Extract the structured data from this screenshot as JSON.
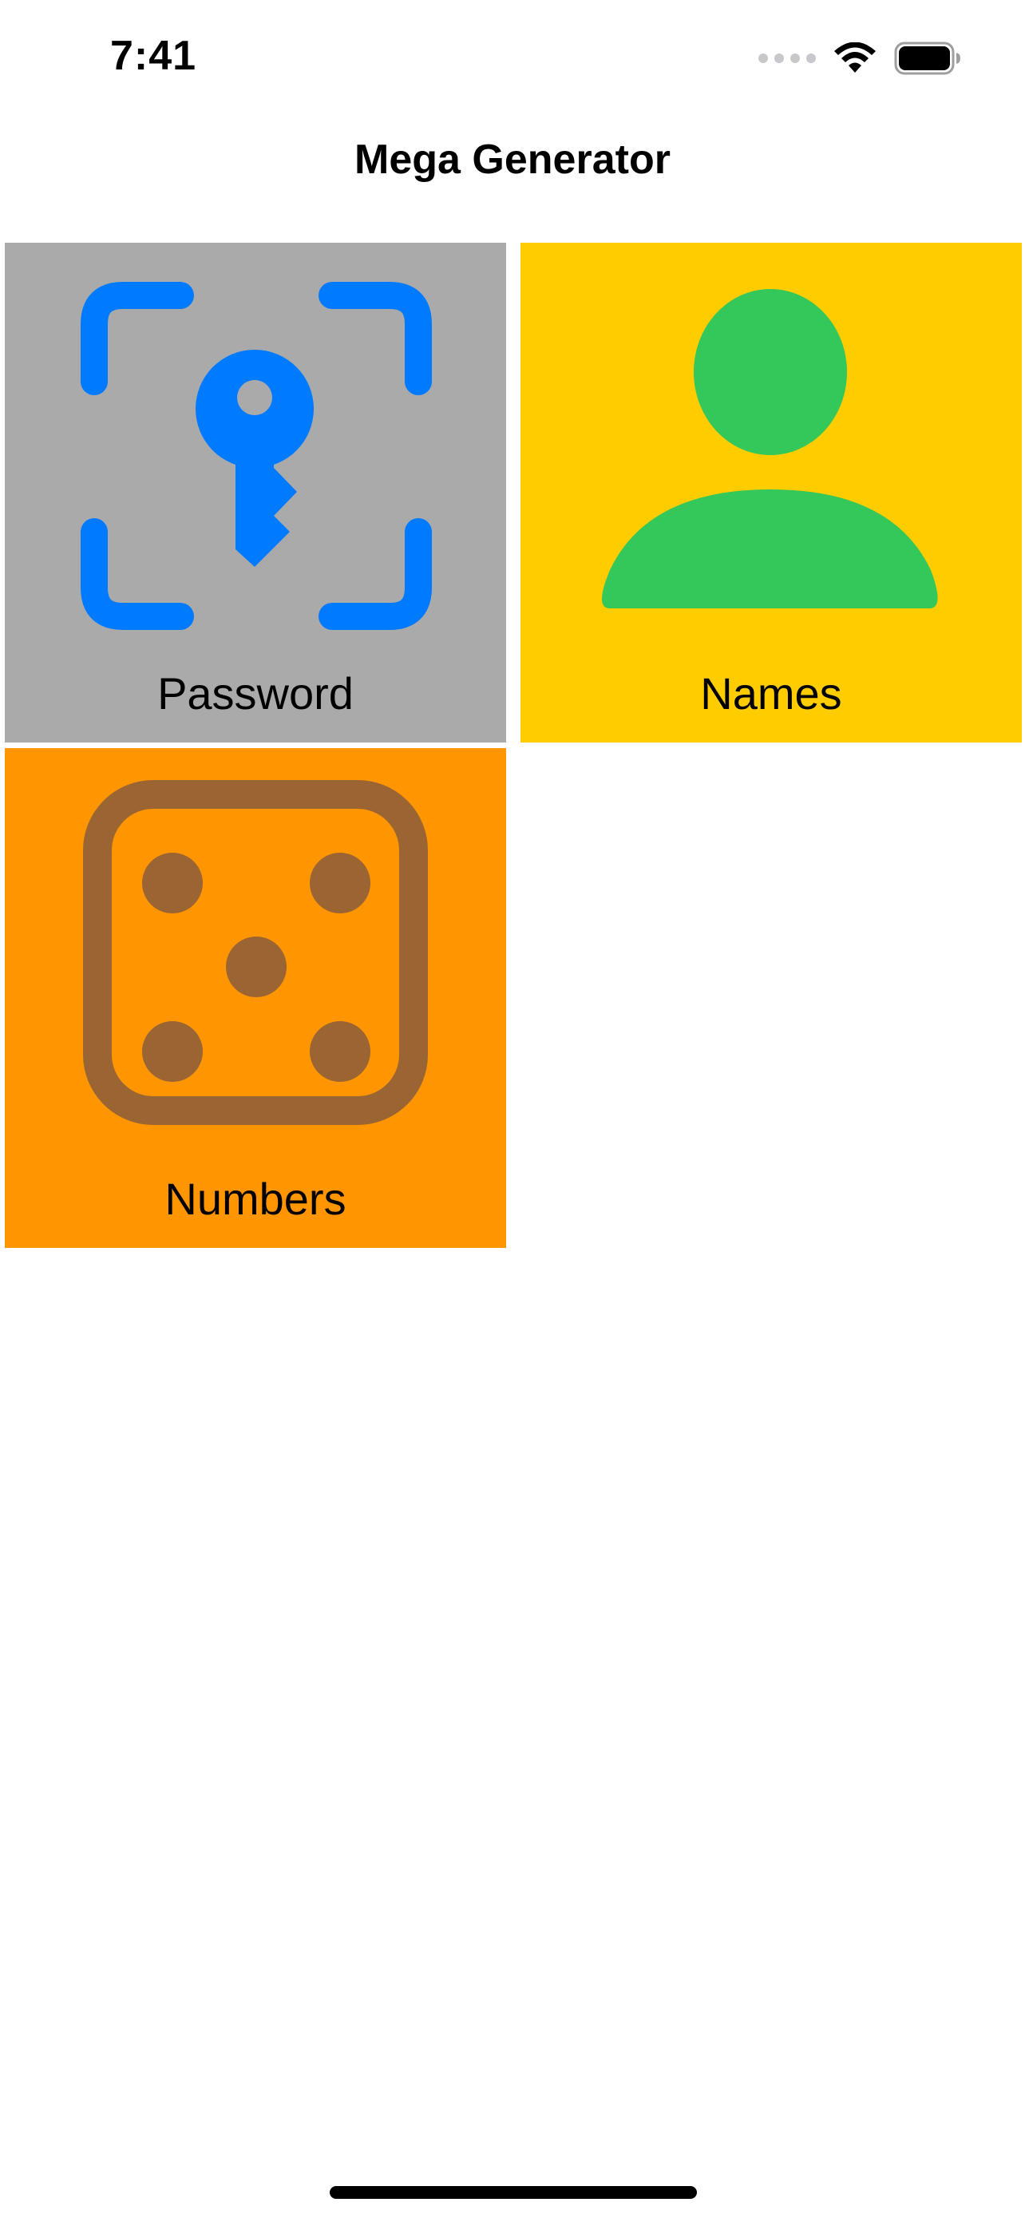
{
  "status_bar": {
    "time": "7:41",
    "signal_icon": "cellular-signal-icon",
    "wifi_icon": "wifi-icon",
    "battery_icon": "battery-icon"
  },
  "nav": {
    "title": "Mega Generator"
  },
  "tiles": [
    {
      "label": "Password",
      "icon": "key-viewfinder-icon",
      "background": "#aaaaaa",
      "icon_color": "#007aff"
    },
    {
      "label": "Names",
      "icon": "person-icon",
      "background": "#ffcc00",
      "icon_color": "#34c759"
    },
    {
      "label": "Numbers",
      "icon": "dice-icon",
      "background": "#ff9500",
      "icon_color": "#9a6533"
    }
  ]
}
